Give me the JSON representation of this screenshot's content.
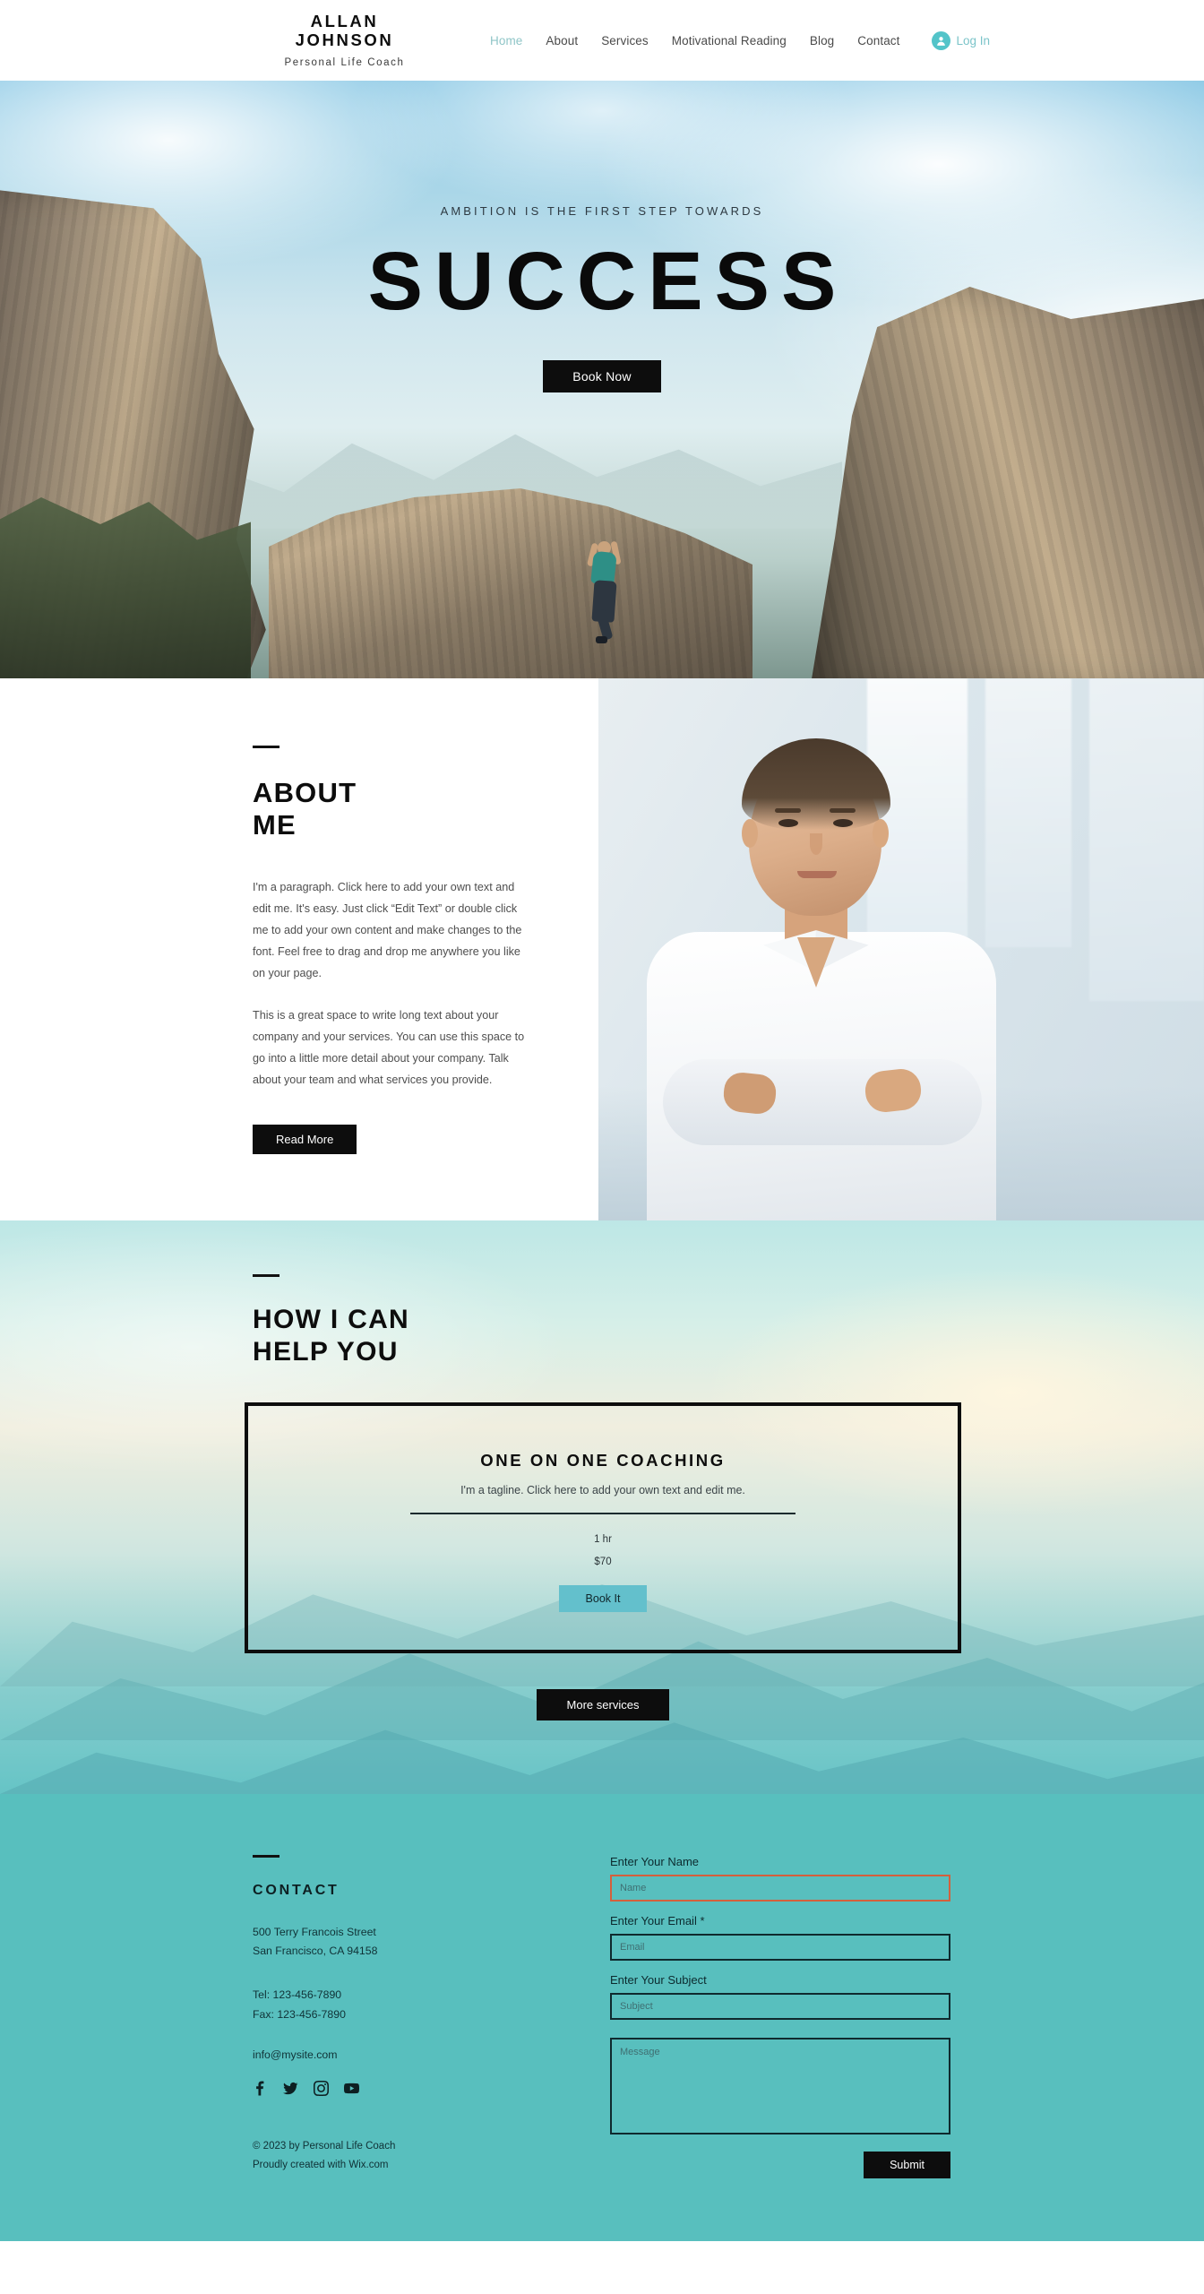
{
  "header": {
    "brand_name": "ALLAN JOHNSON",
    "brand_subtitle": "Personal Life Coach",
    "nav": [
      {
        "label": "Home",
        "active": true
      },
      {
        "label": "About",
        "active": false
      },
      {
        "label": "Services",
        "active": false
      },
      {
        "label": "Motivational Reading",
        "active": false
      },
      {
        "label": "Blog",
        "active": false
      },
      {
        "label": "Contact",
        "active": false
      }
    ],
    "login_label": "Log In",
    "accent_color": "#53c4c9"
  },
  "hero": {
    "eyebrow": "AMBITION IS THE FIRST STEP TOWARDS",
    "title": "SUCCESS",
    "cta_label": "Book Now"
  },
  "about": {
    "heading_line1": "ABOUT",
    "heading_line2": "ME",
    "paragraph1": "I'm a paragraph. Click here to add your own text and edit me. It's easy. Just click “Edit Text” or double click me to add your own content and make changes to the font. Feel free to drag and drop me anywhere you like on your page.",
    "paragraph2": "This is a great space to write long text about your company and your services. You can use this space to go into a little more detail about your company. Talk about your team and what services you provide.",
    "cta_label": "Read More"
  },
  "services": {
    "heading_line1": "HOW I CAN",
    "heading_line2": "HELP YOU",
    "card": {
      "title": "ONE ON ONE COACHING",
      "tagline": "I'm a tagline. Click here to add your own text and edit me.",
      "duration": "1 hr",
      "price": "$70",
      "book_label": "Book It",
      "book_color": "#63c0cc"
    },
    "more_label": "More services"
  },
  "footer": {
    "title": "CONTACT",
    "address_line1": "500 Terry Francois Street",
    "address_line2": "San Francisco, CA 94158",
    "tel": "Tel: 123-456-7890",
    "fax": "Fax: 123-456-7890",
    "email": "info@mysite.com",
    "socials": [
      "facebook-icon",
      "twitter-icon",
      "instagram-icon",
      "youtube-icon"
    ],
    "copyright_line1": "© 2023 by Personal Life Coach",
    "copyright_line2": "Proudly created with Wix.com",
    "form": {
      "name_label": "Enter Your Name",
      "name_placeholder": "Name",
      "name_value": "",
      "name_error": true,
      "email_label": "Enter Your Email *",
      "email_placeholder": "Email",
      "email_value": "",
      "subject_label": "Enter Your Subject",
      "subject_placeholder": "Subject",
      "subject_value": "",
      "message_placeholder": "Message",
      "message_value": "",
      "submit_label": "Submit",
      "error_color": "#d4603c"
    },
    "background_color": "#58bfbe"
  }
}
